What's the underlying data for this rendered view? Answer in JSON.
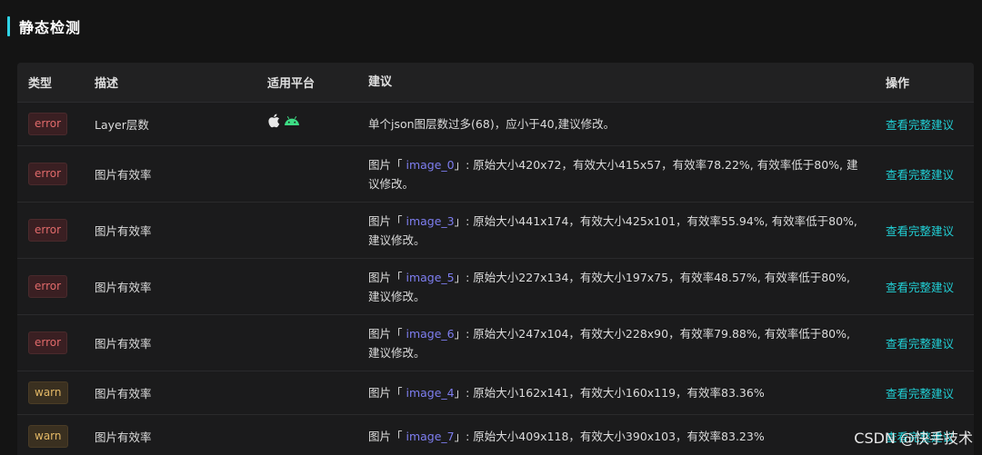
{
  "section": {
    "title": "静态检测"
  },
  "table": {
    "headers": {
      "type": "类型",
      "desc": "描述",
      "platform": "适用平台",
      "suggestion": "建议",
      "op": "操作"
    },
    "rows": [
      {
        "type": "error",
        "desc": "Layer层数",
        "sug_plain": "单个json图层数过多(68)，应小于40,建议修改。",
        "link": "查看完整建议"
      },
      {
        "type": "error",
        "desc": "图片有效率",
        "sug_pre": "图片「 ",
        "img": "image_0",
        "sug_post": "」: 原始大小420x72，有效大小415x57，有效率78.22%, 有效率低于80%, 建议修改。",
        "link": "查看完整建议"
      },
      {
        "type": "error",
        "desc": "图片有效率",
        "sug_pre": "图片「 ",
        "img": "image_3",
        "sug_post": "」: 原始大小441x174，有效大小425x101，有效率55.94%, 有效率低于80%, 建议修改。",
        "link": "查看完整建议"
      },
      {
        "type": "error",
        "desc": "图片有效率",
        "sug_pre": "图片「 ",
        "img": "image_5",
        "sug_post": "」: 原始大小227x134，有效大小197x75，有效率48.57%, 有效率低于80%, 建议修改。",
        "link": "查看完整建议"
      },
      {
        "type": "error",
        "desc": "图片有效率",
        "sug_pre": "图片「 ",
        "img": "image_6",
        "sug_post": "」: 原始大小247x104，有效大小228x90，有效率79.88%, 有效率低于80%, 建议修改。",
        "link": "查看完整建议"
      },
      {
        "type": "warn",
        "desc": "图片有效率",
        "sug_pre": "图片「 ",
        "img": "image_4",
        "sug_post": "」: 原始大小162x141，有效大小160x119，有效率83.36%",
        "link": "查看完整建议"
      },
      {
        "type": "warn",
        "desc": "图片有效率",
        "sug_pre": "图片「 ",
        "img": "image_7",
        "sug_post": "」: 原始大小409x118，有效大小390x103，有效率83.23%",
        "link": "查看完整建议"
      }
    ]
  },
  "watermark": "CSDN @快手技术",
  "colors": {
    "accent": "#2fd3e6",
    "link": "#21d0d6",
    "error": "#e06a6a",
    "warn": "#e3b866",
    "image_name": "#7e7ef0"
  }
}
